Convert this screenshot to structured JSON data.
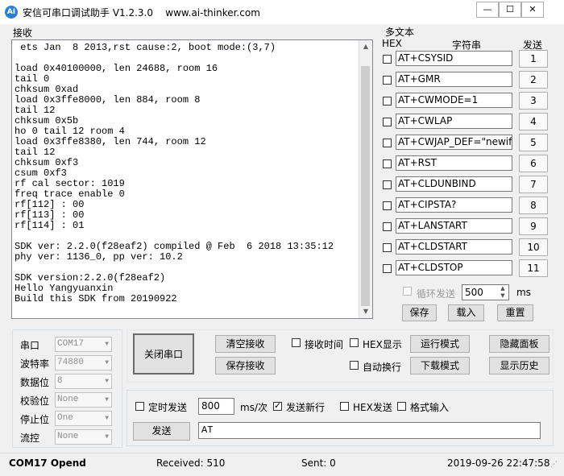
{
  "window": {
    "icon_label": "AI",
    "title": "安信可串口调试助手 V1.2.3.0",
    "url": "www.ai-thinker.com"
  },
  "receive": {
    "label": "接收",
    "text": " ets Jan  8 2013,rst cause:2, boot mode:(3,7)\n\nload 0x40100000, len 24688, room 16\ntail 0\nchksum 0xad\nload 0x3ffe8000, len 884, room 8\ntail 12\nchksum 0x5b\nho 0 tail 12 room 4\nload 0x3ffe8380, len 744, room 12\ntail 12\nchksum 0xf3\ncsum 0xf3\nrf cal sector: 1019\nfreq trace enable 0\nrf[112] : 00\nrf[113] : 00\nrf[114] : 01\n\nSDK ver: 2.2.0(f28eaf2) compiled @ Feb  6 2018 13:35:12\nphy ver: 1136_0, pp ver: 10.2\n\nSDK version:2.2.0(f28eaf2)\nHello Yangyuanxin\nBuild this SDK from 20190922"
  },
  "multi": {
    "title": "多文本",
    "hex_header": "HEX",
    "string_header": "字符串",
    "send_header": "发送",
    "rows": [
      {
        "cmd": "AT+CSYSID",
        "num": "1"
      },
      {
        "cmd": "AT+GMR",
        "num": "2"
      },
      {
        "cmd": "AT+CWMODE=1",
        "num": "3"
      },
      {
        "cmd": "AT+CWLAP",
        "num": "4"
      },
      {
        "cmd": "AT+CWJAP_DEF=\"newifi_",
        "num": "5"
      },
      {
        "cmd": "AT+RST",
        "num": "6"
      },
      {
        "cmd": "AT+CLDUNBIND",
        "num": "7"
      },
      {
        "cmd": "AT+CIPSTA?",
        "num": "8"
      },
      {
        "cmd": "AT+LANSTART",
        "num": "9"
      },
      {
        "cmd": "AT+CLDSTART",
        "num": "10"
      },
      {
        "cmd": "AT+CLDSTOP",
        "num": "11"
      }
    ],
    "loop_label": "循环发送",
    "loop_value": "500",
    "ms_label": "ms",
    "save": "保存",
    "load": "载入",
    "reset": "重置"
  },
  "serial": {
    "port_label": "串口",
    "port_value": "COM17",
    "baud_label": "波特率",
    "baud_value": "74880",
    "data_label": "数据位",
    "data_value": "8",
    "parity_label": "校验位",
    "parity_value": "None",
    "stop_label": "停止位",
    "stop_value": "One",
    "flow_label": "流控",
    "flow_value": "None"
  },
  "controls": {
    "close_port": "关闭串口",
    "clear_recv": "清空接收",
    "save_recv": "保存接收",
    "recv_time": "接收时间",
    "hex_display": "HEX显示",
    "run_mode": "运行模式",
    "hide_panel": "隐藏面板",
    "auto_newline": "自动换行",
    "download_mode": "下载模式",
    "show_history": "显示历史"
  },
  "send": {
    "timed_send": "定时发送",
    "interval": "800",
    "interval_unit": "ms/次",
    "send_newline": "发送新行",
    "hex_send": "HEX发送",
    "format_input": "格式输入",
    "send_button": "发送",
    "input_value": "AT"
  },
  "status": {
    "port_state": "COM17 Opend",
    "received": "Received: 510",
    "sent": "Sent: 0",
    "datetime": "2019-09-26 22:47:58"
  }
}
